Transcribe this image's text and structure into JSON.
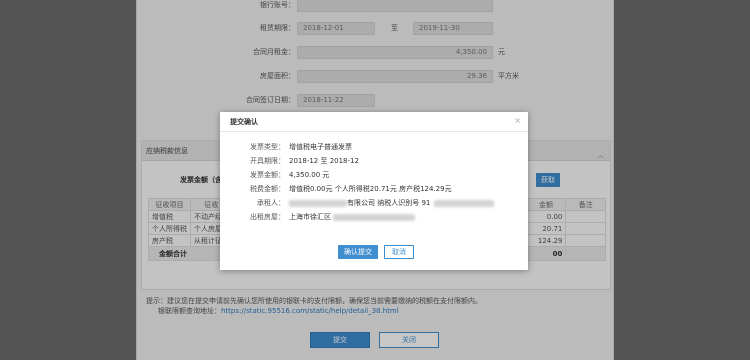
{
  "form": {
    "bank_account_label": "银行账号：",
    "lease_period_label": "租赁期限：",
    "lease_start": "2018-12-01",
    "lease_to": "至",
    "lease_end": "2019-11-30",
    "monthly_rent_label": "合同月租金：",
    "monthly_rent": "4,350.00",
    "monthly_rent_unit": "元",
    "area_label": "房屋面积：",
    "area": "29.36",
    "area_unit": "平方米",
    "sign_date_label": "合同签订日期：",
    "sign_date": "2018-11-22"
  },
  "tax_section": {
    "title": "应纳税款信息",
    "amount_label": "发票金额（含",
    "fill_button": "获取",
    "columns": [
      "征收项目",
      "征收",
      "",
      "",
      "",
      "金额",
      "备注"
    ],
    "rows": [
      {
        "item": "增值税",
        "sub": "不动产经",
        "amount": "0.00"
      },
      {
        "item": "个人所得税",
        "sub": "个人房屋",
        "amount": "20.71"
      },
      {
        "item": "房产税",
        "sub": "从租计征",
        "amount": "124.29"
      }
    ],
    "total_label": "金额合计",
    "total_value": "00"
  },
  "tip": {
    "line1": "提示：建议您在提交申请前先确认您所使用的银联卡的支付限额，确保您当前需要缴纳的税额在支付限额内。",
    "line2_prefix": "银联限额查询地址：",
    "line2_link": "https://static.95516.com/static/help/detail_38.html"
  },
  "buttons": {
    "submit": "提交",
    "close": "关闭"
  },
  "modal": {
    "title": "提交确认",
    "close_glyph": "×",
    "invoice_type_label": "发票类型：",
    "invoice_type": "增值税电子普通发票",
    "period_label": "开具期限：",
    "period": "2018-12 至 2018-12",
    "amount_label": "发票金额：",
    "amount": "4,350.00  元",
    "tax_label": "税费金额：",
    "tax": "增值税0.00元  个人所得税20.71元  房产税124.29元",
    "lessee_label": "承租人：",
    "lessee_suffix": "有限公司  纳税人识别号  91",
    "address_label": "出租房屋：",
    "address": "上海市徐汇区",
    "confirm": "确认提交",
    "cancel": "取消"
  },
  "colors": {
    "accent": "#3e8ed0",
    "overlay": "rgba(0,0,0,0.22)"
  }
}
